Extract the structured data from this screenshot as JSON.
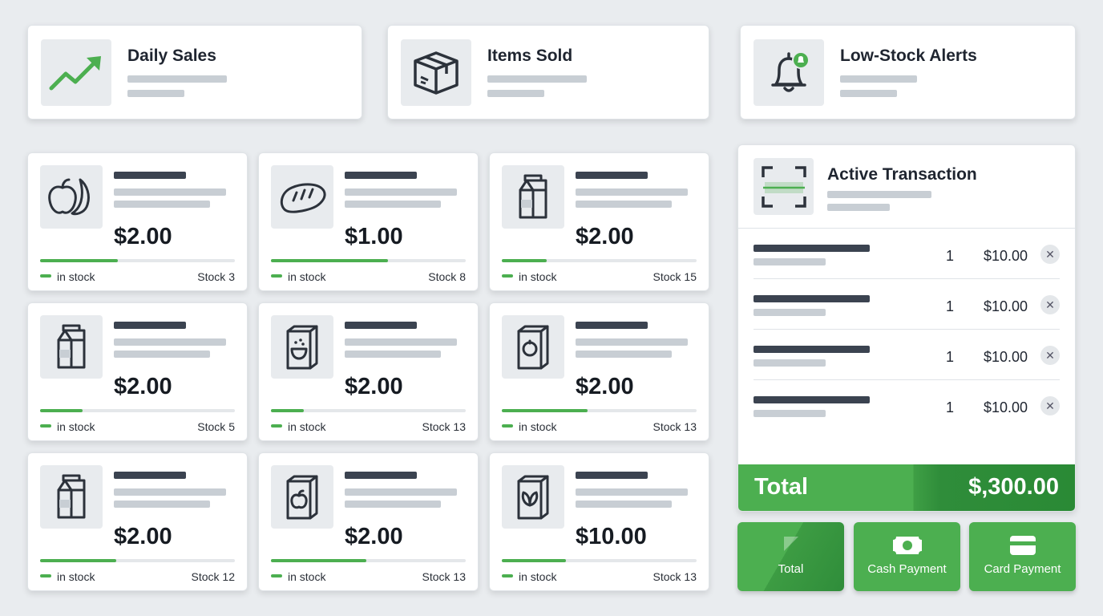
{
  "stats": [
    {
      "title": "Daily Sales",
      "icon": "trend-up-icon"
    },
    {
      "title": "Items Sold",
      "icon": "box-icon"
    },
    {
      "title": "Low-Stock Alerts",
      "icon": "bell-alert-icon"
    }
  ],
  "products": [
    {
      "price": "$2.00",
      "stock_label": "in stock",
      "stock": "Stock 3",
      "level": 0.4,
      "icon": "fruit-icon"
    },
    {
      "price": "$1.00",
      "stock_label": "in stock",
      "stock": "Stock 8",
      "level": 0.6,
      "icon": "bread-icon"
    },
    {
      "price": "$2.00",
      "stock_label": "in stock",
      "stock": "Stock 15",
      "level": 0.23,
      "icon": "milk-carton-icon"
    },
    {
      "price": "$2.00",
      "stock_label": "in stock",
      "stock": "Stock 5",
      "level": 0.22,
      "icon": "milk-carton-icon"
    },
    {
      "price": "$2.00",
      "stock_label": "in stock",
      "stock": "Stock 13",
      "level": 0.17,
      "icon": "cereal-box-icon"
    },
    {
      "price": "$2.00",
      "stock_label": "in stock",
      "stock": "Stock 13",
      "level": 0.44,
      "icon": "snack-box-icon"
    },
    {
      "price": "$2.00",
      "stock_label": "in stock",
      "stock": "Stock 12",
      "level": 0.39,
      "icon": "milk-carton-icon"
    },
    {
      "price": "$2.00",
      "stock_label": "in stock",
      "stock": "Stock 13",
      "level": 0.49,
      "icon": "apple-box-icon"
    },
    {
      "price": "$10.00",
      "stock_label": "in stock",
      "stock": "Stock 13",
      "level": 0.33,
      "icon": "leaf-box-icon"
    }
  ],
  "transaction": {
    "title": "Active Transaction",
    "icon": "barcode-scanner-icon",
    "items": [
      {
        "qty": "1",
        "amount": "$10.00"
      },
      {
        "qty": "1",
        "amount": "$10.00"
      },
      {
        "qty": "1",
        "amount": "$10.00"
      },
      {
        "qty": "1",
        "amount": "$10.00"
      }
    ],
    "remove_glyph": "✕",
    "total_label": "Total",
    "total_amount": "$,300.00"
  },
  "actions": {
    "total": "Total",
    "cash": "Cash Payment",
    "card": "Card Payment"
  },
  "colors": {
    "accent": "#4caf50",
    "accent_dark": "#2a8a35",
    "background": "#e9ecef"
  }
}
